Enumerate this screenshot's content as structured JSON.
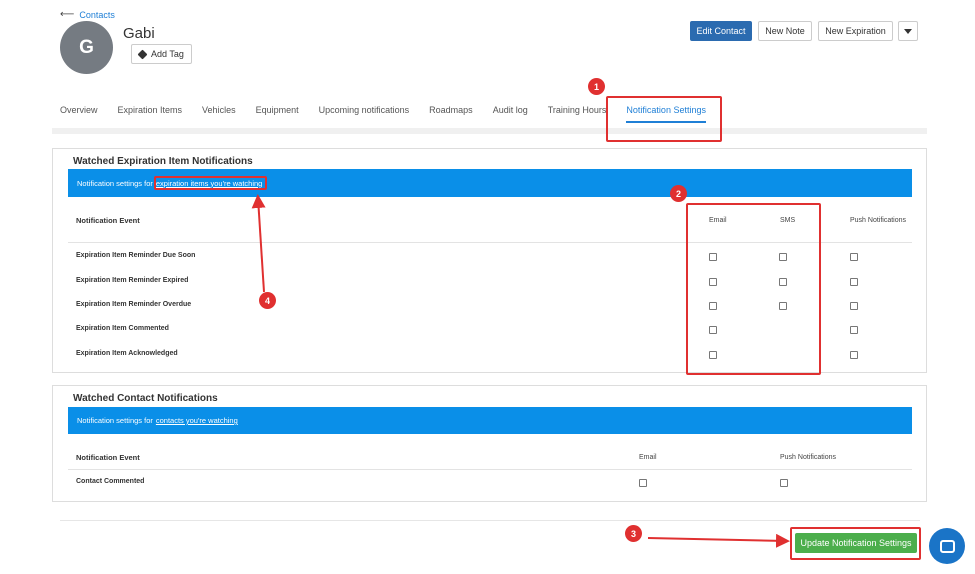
{
  "header": {
    "back_label": "Contacts",
    "avatar_initial": "G",
    "contact_name": "Gabi",
    "add_tag_label": "Add Tag"
  },
  "actions": {
    "edit_contact": "Edit Contact",
    "new_note": "New Note",
    "new_expiration": "New Expiration"
  },
  "tabs": [
    {
      "label": "Overview"
    },
    {
      "label": "Expiration Items"
    },
    {
      "label": "Vehicles"
    },
    {
      "label": "Equipment"
    },
    {
      "label": "Upcoming notifications"
    },
    {
      "label": "Roadmaps"
    },
    {
      "label": "Audit log"
    },
    {
      "label": "Training Hours"
    },
    {
      "label": "Notification Settings",
      "active": true
    }
  ],
  "expiration_panel": {
    "title": "Watched Expiration Item Notifications",
    "banner_prefix": "Notification settings for",
    "banner_link": "expiration items you're watching",
    "event_header": "Notification Event",
    "col_email": "Email",
    "col_sms": "SMS",
    "col_push": "Push Notifications",
    "rows": [
      {
        "label": "Expiration Item Reminder Due Soon",
        "email": false,
        "sms": false,
        "push": false
      },
      {
        "label": "Expiration Item Reminder Expired",
        "email": false,
        "sms": false,
        "push": false
      },
      {
        "label": "Expiration Item Reminder Overdue",
        "email": false,
        "sms": false,
        "push": false
      },
      {
        "label": "Expiration Item Commented",
        "email": false,
        "push": false
      },
      {
        "label": "Expiration Item Acknowledged",
        "email": false,
        "push": false
      }
    ]
  },
  "contact_panel": {
    "title": "Watched Contact Notifications",
    "banner_prefix": "Notification settings for",
    "banner_link": "contacts you're watching",
    "event_header": "Notification Event",
    "col_email": "Email",
    "col_push": "Push Notifications",
    "rows": [
      {
        "label": "Contact Commented",
        "email": false,
        "push": false
      }
    ]
  },
  "footer": {
    "update_button": "Update Notification Settings"
  },
  "annotations": {
    "badges": [
      "1",
      "2",
      "3",
      "4"
    ],
    "color": "#e03030"
  },
  "colors": {
    "primary": "#2b6bb0",
    "banner": "#0a8fe8",
    "success": "#4cae4c",
    "link": "#1f7fd6"
  }
}
